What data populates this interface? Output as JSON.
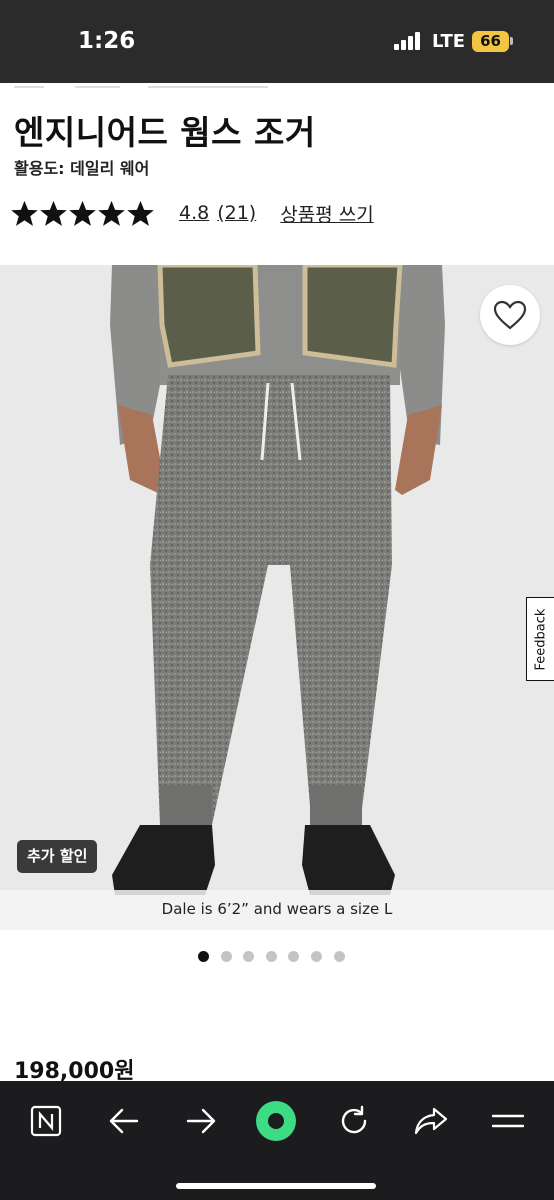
{
  "status_bar": {
    "time": "1:26",
    "network": "LTE",
    "battery": "66"
  },
  "product": {
    "title": "엔지니어드 웜스 조거",
    "activity": "활용도: 데일리 웨어",
    "rating": {
      "stars": 5,
      "value": "4.8",
      "count": "(21)",
      "write_review": "상품평 쓰기"
    },
    "promo_badge": "추가 할인",
    "model_caption": "Dale is 6’2” and wears a size L",
    "feedback": "Feedback",
    "carousel": {
      "total": 7,
      "active": 1
    },
    "price": "198,000원"
  },
  "colors": {
    "accent_reader": "#3ddc84",
    "toolbar_bg": "#1c1c1e",
    "status_bg": "#2b2b2b",
    "battery": "#f4c542"
  },
  "icons": {
    "wishlist": "heart-icon",
    "toolbar": [
      "notion-icon",
      "back-arrow-icon",
      "forward-arrow-icon",
      "reader-mode-icon",
      "reload-icon",
      "share-icon",
      "menu-icon"
    ]
  }
}
